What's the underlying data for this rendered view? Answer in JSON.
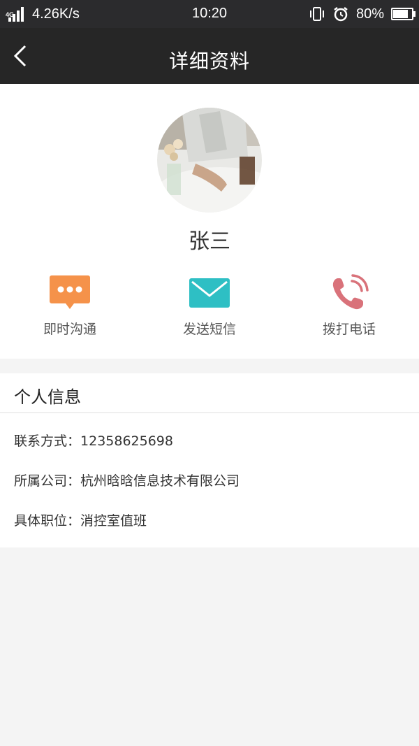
{
  "status_bar": {
    "network": "4G",
    "speed": "4.26K/s",
    "time": "10:20",
    "battery": "80%",
    "battery_level": 0.8
  },
  "header": {
    "title": "详细资料",
    "back_icon": "chevron-left-icon"
  },
  "profile": {
    "name": "张三",
    "actions": [
      {
        "label": "即时沟通",
        "icon": "chat-bubble-icon",
        "color": "#f5924a"
      },
      {
        "label": "发送短信",
        "icon": "envelope-icon",
        "color": "#2ebfc4"
      },
      {
        "label": "拨打电话",
        "icon": "phone-icon",
        "color": "#d9727a"
      }
    ]
  },
  "personal_info": {
    "title": "个人信息",
    "rows": [
      {
        "key": "联系方式：",
        "value": "12358625698"
      },
      {
        "key": "所属公司：",
        "value": "杭州晗晗信息技术有限公司"
      },
      {
        "key": "具体职位：",
        "value": "消控室值班"
      }
    ]
  }
}
